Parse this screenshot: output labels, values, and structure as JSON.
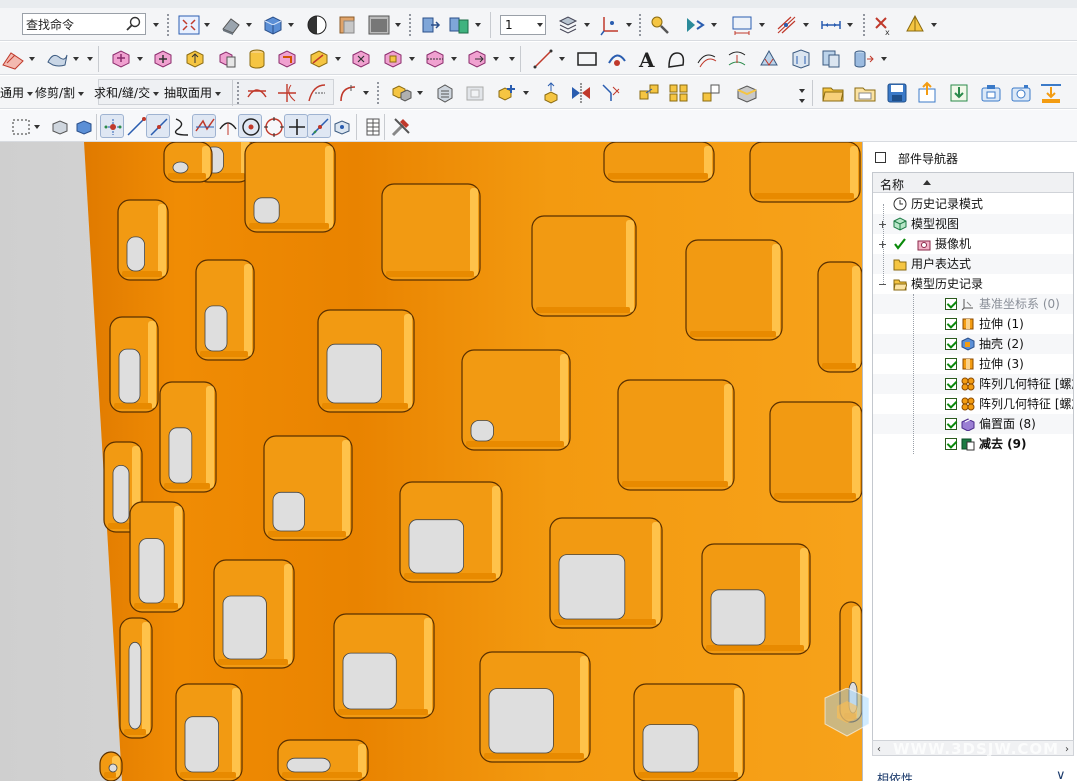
{
  "toolbar": {
    "search": {
      "value": "查找命令",
      "placeholder": "查找命令"
    },
    "spin_value": "1",
    "menus": {
      "common": "通用",
      "trim": "修剪/割",
      "combine": "求和/缝/交",
      "extract": "抽取面用"
    }
  },
  "navigator": {
    "title": "部件导航器",
    "column_name": "名称",
    "nodes": [
      {
        "label": "历史记录模式",
        "icon": "clock-icon"
      },
      {
        "label": "模型视图",
        "icon": "cube-view-icon"
      },
      {
        "label": "摄像机",
        "icon": "camera-icon"
      },
      {
        "label": "用户表达式",
        "icon": "folder-icon"
      },
      {
        "label": "模型历史记录",
        "icon": "folder-open-icon"
      },
      {
        "label": "基准坐标系 (0)",
        "icon": "datum-csys-icon"
      },
      {
        "label": "拉伸 (1)",
        "icon": "extrude-icon"
      },
      {
        "label": "抽壳 (2)",
        "icon": "shell-icon"
      },
      {
        "label": "拉伸 (3)",
        "icon": "extrude-icon"
      },
      {
        "label": "阵列几何特征 [螺旋] ...",
        "icon": "pattern-icon"
      },
      {
        "label": "阵列几何特征 [螺旋] ...",
        "icon": "pattern-icon"
      },
      {
        "label": "偏置面 (8)",
        "icon": "offset-face-icon"
      },
      {
        "label": "减去 (9)",
        "icon": "subtract-icon"
      }
    ],
    "dependencies_label": "相依性"
  },
  "watermark": "WWW.3DSJW.COM",
  "colors": {
    "part_orange": "#f39c12",
    "background": "#d8d8d8",
    "toolbar_bg": "#f4f5f7",
    "checkbox_green": "#0a8a0a"
  }
}
